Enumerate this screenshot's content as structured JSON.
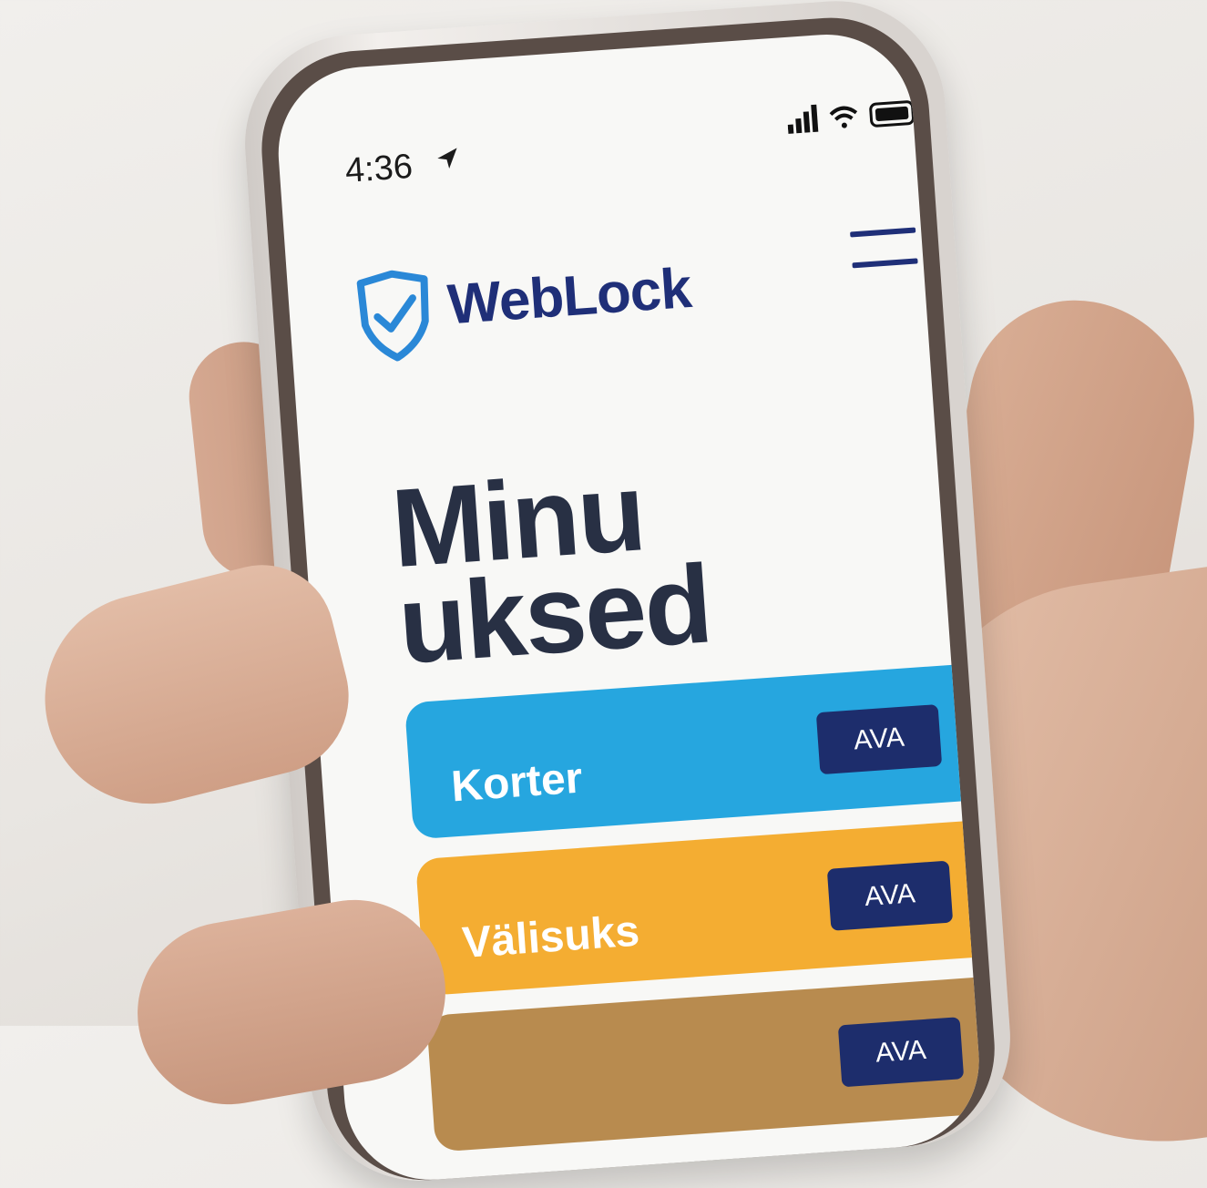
{
  "status_bar": {
    "time": "4:36"
  },
  "header": {
    "brand": "WebLock"
  },
  "page": {
    "title_line1": "Minu",
    "title_line2": "uksed"
  },
  "doors": [
    {
      "name": "Korter",
      "button": "AVA",
      "color": "#26a6df"
    },
    {
      "name": "Välisuks",
      "button": "AVA",
      "color": "#f4ad32"
    },
    {
      "name": "",
      "button": "AVA",
      "color": "#b88b4f"
    }
  ],
  "colors": {
    "brand": "#1f2f78",
    "logo_shield": "#2a88d7",
    "button": "#1d2d6c"
  }
}
